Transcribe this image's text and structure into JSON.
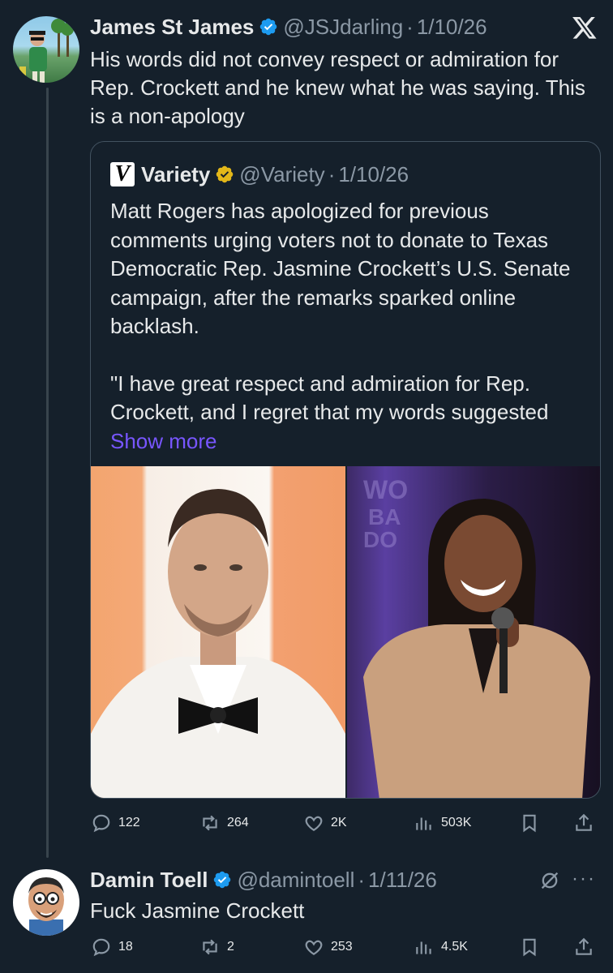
{
  "post1": {
    "name": "James St James",
    "handle": "@JSJdarling",
    "date": "1/10/26",
    "text": "His words did not convey respect or admiration for Rep. Crockett and he knew what he was saying. This is a non-apology",
    "quote": {
      "name": "Variety",
      "handle": "@Variety",
      "date": "1/10/26",
      "para1": "Matt Rogers has apologized for previous comments urging voters not to donate to Texas Democratic Rep. Jasmine Crockett’s U.S. Senate campaign, after the remarks sparked online backlash.",
      "para2": "\"I have great respect and admiration for Rep. Crockett, and I regret that my words suggested",
      "show_more": "Show more"
    },
    "stats": {
      "replies": "122",
      "reposts": "264",
      "likes": "2K",
      "views": "503K"
    }
  },
  "post2": {
    "name": "Damin Toell",
    "handle": "@damintoell",
    "date": "1/11/26",
    "text": "Fuck Jasmine Crockett",
    "stats": {
      "replies": "18",
      "reposts": "2",
      "likes": "253",
      "views": "4.5K"
    }
  },
  "colors": {
    "background": "#15202b",
    "muted": "#8b98a5",
    "accent": "#7856ff",
    "verified_blue": "#1d9bf0",
    "verified_gold": "#e2b719"
  },
  "icons": [
    "x-logo",
    "verified-icon",
    "reply-icon",
    "repost-icon",
    "like-icon",
    "views-icon",
    "bookmark-icon",
    "share-icon",
    "mute-icon",
    "more-icon"
  ]
}
